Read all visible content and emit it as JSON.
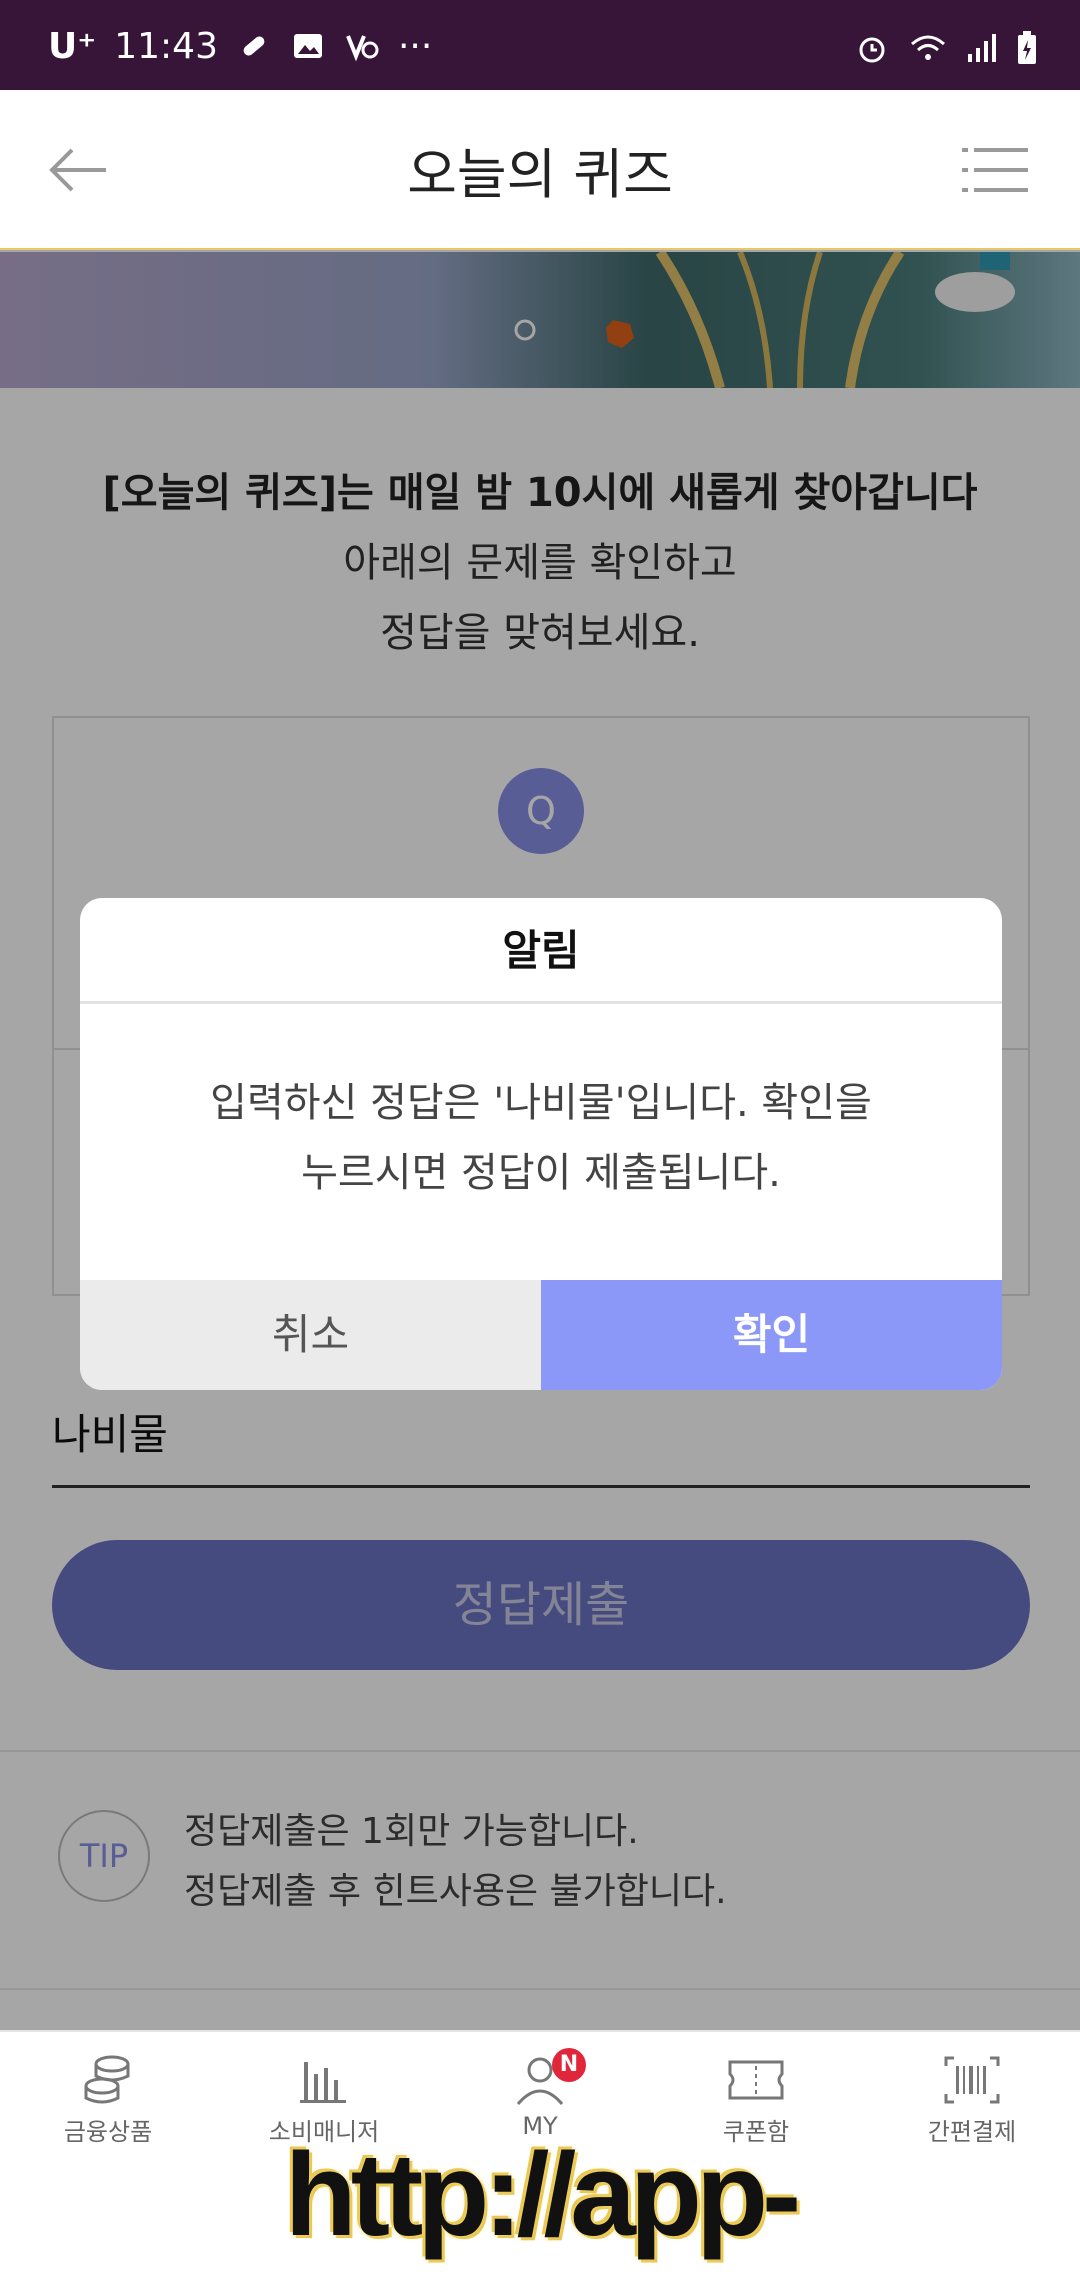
{
  "status_bar": {
    "carrier": "U⁺",
    "time": "11:43",
    "more": "···"
  },
  "header": {
    "title": "오늘의 퀴즈"
  },
  "intro": {
    "line1": "[오늘의 퀴즈]는 매일 밤 10시에 새롭게 찾아갑니다",
    "line2": "아래의 문제를 확인하고",
    "line3": "정답을 맞혀보세요."
  },
  "question": {
    "badge": "Q"
  },
  "answer": {
    "value": "나비물"
  },
  "submit_label": "정답제출",
  "tip": {
    "badge": "TIP",
    "line1": "정답제출은 1회만 가능합니다.",
    "line2": "정답제출 후 힌트사용은 불가합니다."
  },
  "dialog": {
    "title": "알림",
    "message_line1": "입력하신 정답은 '나비물'입니다. 확인을",
    "message_line2": "누르시면 정답이 제출됩니다.",
    "cancel_label": "취소",
    "ok_label": "확인"
  },
  "bottom_nav": {
    "items": [
      {
        "label": "금융상품",
        "icon": "coins-icon"
      },
      {
        "label": "소비매니저",
        "icon": "bar-chart-icon"
      },
      {
        "label": "MY",
        "icon": "user-icon",
        "badge": "N"
      },
      {
        "label": "쿠폰함",
        "icon": "ticket-icon"
      },
      {
        "label": "간편결제",
        "icon": "barcode-icon"
      }
    ]
  },
  "watermark": "http://app-tech.tistory.com",
  "colors": {
    "status_bar_bg": "#361538",
    "accent": "#8c98f8",
    "submit_bg": "#6c74c4",
    "badge_red": "#e0263b"
  }
}
